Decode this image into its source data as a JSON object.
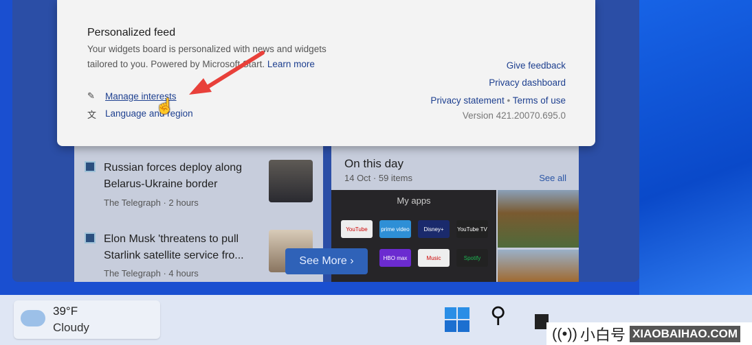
{
  "popup": {
    "title": "Personalized feed",
    "description": "Your widgets board is personalized with news and widgets tailored to you. Powered by Microsoft Start.",
    "learn_more": "Learn more",
    "manage_interests": "Manage interests",
    "language_region": "Language and region",
    "give_feedback": "Give feedback",
    "privacy_dashboard": "Privacy dashboard",
    "privacy_statement": "Privacy statement",
    "separator": "•",
    "terms_of_use": "Terms of use",
    "version": "Version 421.20070.695.0"
  },
  "news": [
    {
      "title": "Russian forces deploy along Belarus-Ukraine border",
      "source": "The Telegraph · 2 hours"
    },
    {
      "title": "Elon Musk 'threatens to pull Starlink satellite service fro...",
      "source": "The Telegraph · 4 hours"
    }
  ],
  "see_more": "See More",
  "on_this_day": {
    "title": "On this day",
    "subtitle": "14 Oct · 59 items",
    "see_all": "See all",
    "apps_title": "My apps",
    "apps": [
      "YouTube",
      "prime video",
      "Disney+",
      "YouTube TV",
      "HBO max",
      "Music",
      "Spotify"
    ]
  },
  "weather": {
    "temp": "39°F",
    "condition": "Cloudy"
  },
  "watermark": {
    "text": "小白号",
    "site": "XIAOBAIHAO.COM"
  },
  "colors": {
    "accent": "#1d3f8f",
    "arrow": "#e8403a",
    "desktop": "#1a4fd0"
  }
}
